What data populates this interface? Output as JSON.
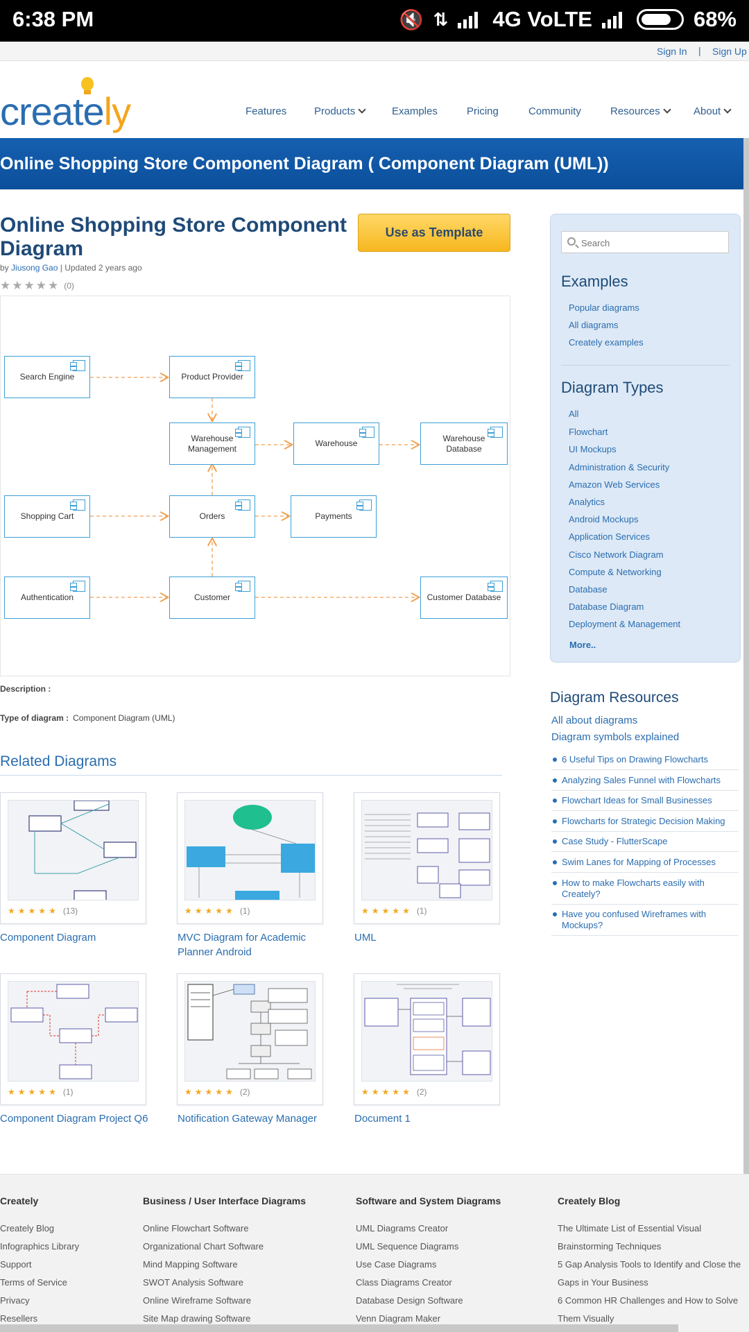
{
  "status_bar": {
    "time": "6:38 PM",
    "network": "4G VoLTE",
    "battery": "68%"
  },
  "topbar": {
    "sign_in": "Sign In",
    "separator": "|",
    "sign_up": "Sign Up"
  },
  "logo": {
    "text_main": "create",
    "text_accent": "ly",
    "accent_color": "#f4a51c",
    "brand_color": "#2a6db0"
  },
  "nav": {
    "items": [
      {
        "label": "Features"
      },
      {
        "label": "Products"
      },
      {
        "label": "Examples"
      },
      {
        "label": "Pricing"
      },
      {
        "label": "Community"
      },
      {
        "label": "Resources"
      },
      {
        "label": "About"
      }
    ]
  },
  "banner": {
    "title": "Online Shopping Store Component Diagram ( Component Diagram (UML))"
  },
  "diagram_page": {
    "title": "Online Shopping Store Component Diagram",
    "by_prefix": "by",
    "author": "Jiusong Gao",
    "updated": "| Updated 2 years ago",
    "rating_count": "(0)",
    "use_template": "Use as Template",
    "description_label": "Description :",
    "type_label": "Type of diagram :",
    "type_value": "Component Diagram (UML)"
  },
  "diagram": {
    "components": [
      "Search Engine",
      "Product Provider",
      "Warehouse Management",
      "Warehouse",
      "Warehouse Database",
      "Shopping Cart",
      "Orders",
      "Payments",
      "Authentication",
      "Customer",
      "Customer Database"
    ],
    "line_color": "#f0a050",
    "box_color": "#3d9fd6"
  },
  "related": {
    "title": "Related Diagrams",
    "cards": [
      {
        "title": "Component Diagram",
        "count": "(13)"
      },
      {
        "title": "MVC Diagram for Academic Planner Android",
        "count": "(1)"
      },
      {
        "title": "UML",
        "count": "(1)"
      },
      {
        "title": "Component Diagram Project Q6",
        "count": "(1)"
      },
      {
        "title": "Notification Gateway Manager",
        "count": "(2)"
      },
      {
        "title": "Document 1",
        "count": "(2)"
      }
    ]
  },
  "sidebar": {
    "search_placeholder": "Search",
    "examples_heading": "Examples",
    "examples": [
      "Popular diagrams",
      "All diagrams",
      "Creately examples"
    ],
    "types_heading": "Diagram Types",
    "types": [
      "All",
      "Flowchart",
      "UI Mockups",
      "Administration & Security",
      "Amazon Web Services",
      "Analytics",
      "Android Mockups",
      "Application Services",
      "Cisco Network Diagram",
      "Compute & Networking",
      "Database",
      "Database Diagram",
      "Deployment & Management"
    ],
    "more": "More.."
  },
  "resources": {
    "title": "Diagram Resources",
    "links": [
      "All about diagrams",
      "Diagram symbols explained"
    ],
    "items": [
      "6 Useful Tips on Drawing Flowcharts",
      "Analyzing Sales Funnel with Flowcharts",
      "Flowchart Ideas for Small Businesses",
      "Flowcharts for Strategic Decision Making",
      "Case Study - FlutterScape",
      "Swim Lanes for Mapping of Processes",
      "How to make Flowcharts easily with Creately?",
      "Have you confused Wireframes with Mockups?"
    ]
  },
  "footer": {
    "columns": [
      {
        "heading": "Creately",
        "links": [
          "Creately Blog",
          "Infographics Library",
          "Support",
          "Terms of Service",
          "Privacy",
          "Resellers"
        ]
      },
      {
        "heading": "Business / User Interface Diagrams",
        "links": [
          "Online Flowchart Software",
          "Organizational Chart Software",
          "Mind Mapping Software",
          "SWOT Analysis Software",
          "Online Wireframe Software",
          "Site Map drawing Software"
        ]
      },
      {
        "heading": "Software and System Diagrams",
        "links": [
          "UML Diagrams Creator",
          "UML Sequence Diagrams",
          "Use Case Diagrams",
          "Class Diagrams Creator",
          "Database Design Software",
          "Venn Diagram Maker"
        ]
      },
      {
        "heading": "Creately Blog",
        "links": [
          "The Ultimate List of Essential Visual",
          "Brainstorming Techniques",
          "5 Gap Analysis Tools to Identify and Close the",
          "Gaps in Your Business",
          "6 Common HR Challenges and How to Solve",
          "Them Visually"
        ]
      }
    ]
  }
}
